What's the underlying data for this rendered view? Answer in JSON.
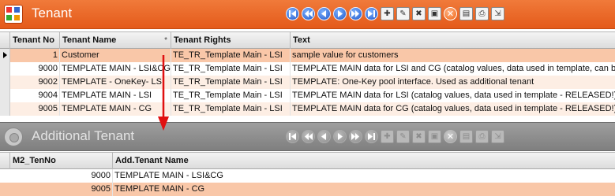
{
  "main_panel": {
    "title": "Tenant",
    "toolbar": [
      {
        "icon": "first-record-icon",
        "type": "nav"
      },
      {
        "icon": "previous-page-icon",
        "type": "nav"
      },
      {
        "icon": "previous-record-icon",
        "type": "nav"
      },
      {
        "icon": "next-record-icon",
        "type": "nav"
      },
      {
        "icon": "next-page-icon",
        "type": "nav"
      },
      {
        "icon": "last-record-icon",
        "type": "nav"
      },
      {
        "icon": "new-record-icon",
        "type": "tool",
        "glyph": "✚"
      },
      {
        "icon": "edit-record-icon",
        "type": "tool",
        "glyph": "✎"
      },
      {
        "icon": "delete-record-icon",
        "type": "tool",
        "glyph": "✖"
      },
      {
        "icon": "save-icon",
        "type": "tool",
        "glyph": "▣"
      },
      {
        "icon": "cancel-icon",
        "type": "stop",
        "glyph": "✕"
      },
      {
        "icon": "form-view-icon",
        "type": "tool",
        "glyph": "▤"
      },
      {
        "icon": "print-icon",
        "type": "tool",
        "glyph": "⎙"
      },
      {
        "icon": "export-icon",
        "type": "tool",
        "glyph": "⇲"
      }
    ],
    "columns": [
      "Tenant No",
      "Tenant Name",
      "Tenant Rights",
      "Text"
    ],
    "sort_marks": {
      "tenant_no": "",
      "tenant_name": "*"
    },
    "rows": [
      {
        "no": "1",
        "name": "Customer",
        "rights": "TE_TR_Template Main - LSI",
        "text": "sample value for customers"
      },
      {
        "no": "9000",
        "name": "TEMPLATE MAIN - LSI&CG",
        "rights": "TE_TR_Template Main - LSI",
        "text": "TEMPLATE MAIN data for LSI and CG  (catalog values, data used in template, can be"
      },
      {
        "no": "9002",
        "name": "TEMPLATE - OneKey- LSI",
        "rights": "TE_TR_Template Main - LSI",
        "text": "TEMPLATE: One-Key pool  interface. Used as additional tenant"
      },
      {
        "no": "9004",
        "name": "TEMPLATE MAIN - LSI",
        "rights": "TE_TR_Template Main - LSI",
        "text": "TEMPLATE MAIN data for LSI (catalog values, data used in template - RELEASED!)"
      },
      {
        "no": "9005",
        "name": "TEMPLATE MAIN - CG",
        "rights": "TE_TR_Template Main - LSI",
        "text": "TEMPLATE MAIN data for CG (catalog values, data used in template - RELEASED!)"
      }
    ]
  },
  "sub_panel": {
    "title": "Additional Tenant",
    "columns": [
      "M2_TenNo",
      "Add.Tenant Name"
    ],
    "rows": [
      {
        "no": "9000",
        "name": "TEMPLATE MAIN - LSI&CG"
      },
      {
        "no": "9005",
        "name": "TEMPLATE MAIN - CG"
      }
    ]
  },
  "colors": {
    "main_header": "#e8621f",
    "sub_header": "#8a8a8a",
    "selected_row": "#f9c7a8",
    "alt_row": "#fdeee4",
    "annotation_arrow": "#e01010"
  }
}
